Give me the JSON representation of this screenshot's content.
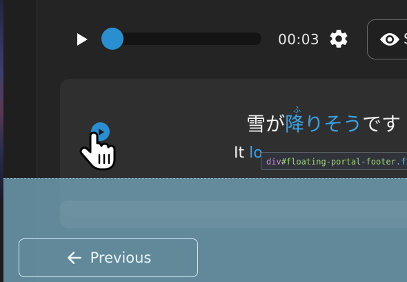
{
  "player": {
    "time": "00:03",
    "progress": 0.0,
    "play_icon": "play-icon",
    "settings_icon": "gear-icon",
    "toggle_icon": "eye-icon",
    "toggle_label": "S"
  },
  "card": {
    "jp_plain1": "雪が",
    "jp_highlight": "降りそう",
    "jp_plain2": "です",
    "furigana": "ふ",
    "en_plain1": "It ",
    "en_highlight": "lo"
  },
  "tooltip": {
    "tag": "div",
    "id": "#floating-portal-footer",
    "cls": ".fixed."
  },
  "footer": {
    "prev_label": "Previous",
    "prev_icon": "arrow-left-icon"
  },
  "colors": {
    "accent": "#2a8fd0",
    "highlight_overlay": "#70a0b4"
  }
}
